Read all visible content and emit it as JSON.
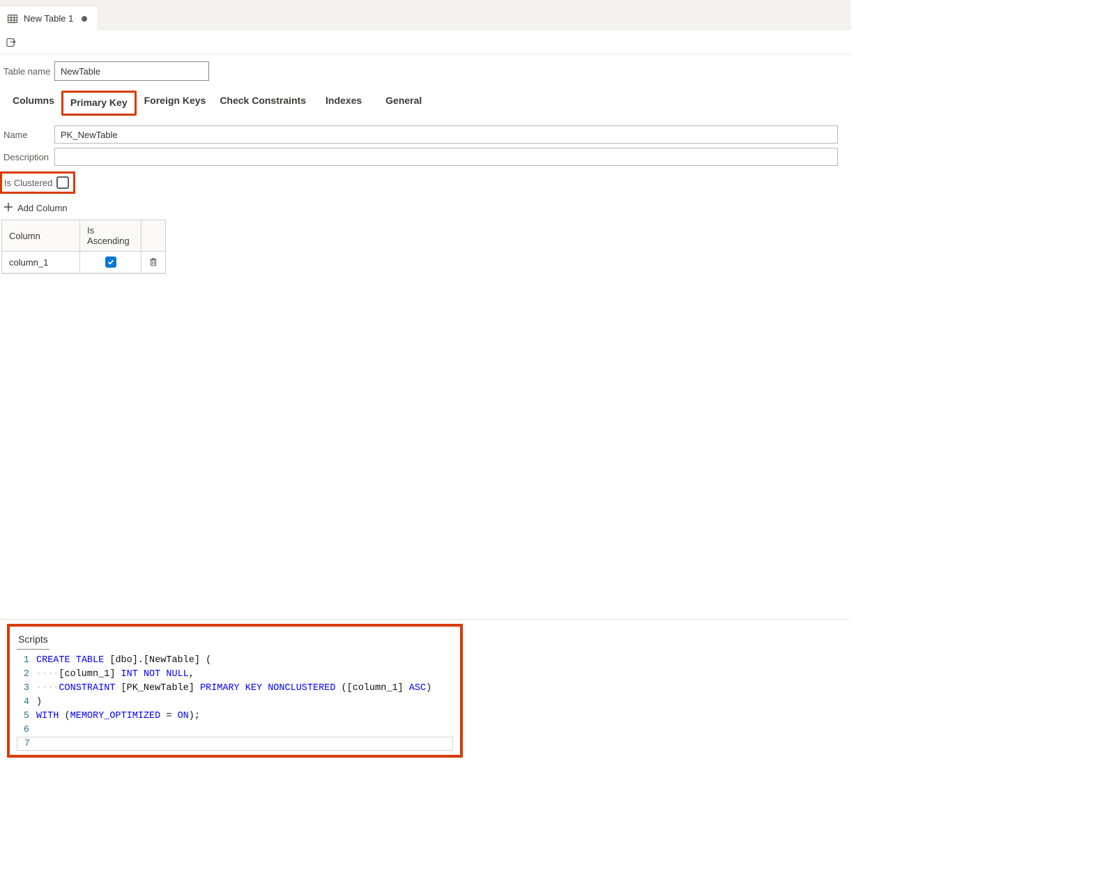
{
  "file_tab": {
    "label": "New Table 1",
    "dirty": true
  },
  "table_name_label": "Table name",
  "table_name_value": "NewTable",
  "subtabs": {
    "columns": "Columns",
    "primary_key": "Primary Key",
    "foreign_keys": "Foreign Keys",
    "check_constraints": "Check Constraints",
    "indexes": "Indexes",
    "general": "General",
    "active": "primary_key"
  },
  "pk_form": {
    "name_label": "Name",
    "name_value": "PK_NewTable",
    "desc_label": "Description",
    "desc_value": "",
    "clustered_label": "Is Clustered",
    "clustered_checked": false
  },
  "add_column_label": "Add Column",
  "grid": {
    "headers": {
      "column": "Column",
      "is_asc": "Is Ascending"
    },
    "rows": [
      {
        "column": "column_1",
        "is_ascending": true
      }
    ]
  },
  "scripts": {
    "title": "Scripts",
    "lines": [
      {
        "n": 1,
        "tokens": [
          [
            "kw",
            "CREATE"
          ],
          [
            "sp",
            " "
          ],
          [
            "kw",
            "TABLE"
          ],
          [
            "sp",
            " "
          ],
          [
            "id",
            "[dbo].[NewTable] ("
          ]
        ]
      },
      {
        "n": 2,
        "tokens": [
          [
            "dots",
            "····"
          ],
          [
            "id",
            "[column_1] "
          ],
          [
            "kw",
            "INT"
          ],
          [
            "sp",
            " "
          ],
          [
            "kw",
            "NOT"
          ],
          [
            "sp",
            " "
          ],
          [
            "kw",
            "NULL"
          ],
          [
            "id",
            ","
          ]
        ]
      },
      {
        "n": 3,
        "tokens": [
          [
            "dots",
            "····"
          ],
          [
            "kw",
            "CONSTRAINT"
          ],
          [
            "sp",
            " "
          ],
          [
            "id",
            "[PK_NewTable] "
          ],
          [
            "kw",
            "PRIMARY"
          ],
          [
            "sp",
            " "
          ],
          [
            "kw",
            "KEY"
          ],
          [
            "sp",
            " "
          ],
          [
            "kw",
            "NONCLUSTERED"
          ],
          [
            "sp",
            " "
          ],
          [
            "id",
            "([column_1] "
          ],
          [
            "kw",
            "ASC"
          ],
          [
            "id",
            ")"
          ]
        ]
      },
      {
        "n": 4,
        "tokens": [
          [
            "id",
            ")"
          ]
        ]
      },
      {
        "n": 5,
        "tokens": [
          [
            "kw",
            "WITH"
          ],
          [
            "sp",
            " "
          ],
          [
            "id",
            "("
          ],
          [
            "kw",
            "MEMORY_OPTIMIZED"
          ],
          [
            "sp",
            " "
          ],
          [
            "id",
            "= "
          ],
          [
            "kw",
            "ON"
          ],
          [
            "id",
            ");"
          ]
        ]
      },
      {
        "n": 6,
        "tokens": []
      },
      {
        "n": 7,
        "tokens": [],
        "current": true
      }
    ]
  }
}
